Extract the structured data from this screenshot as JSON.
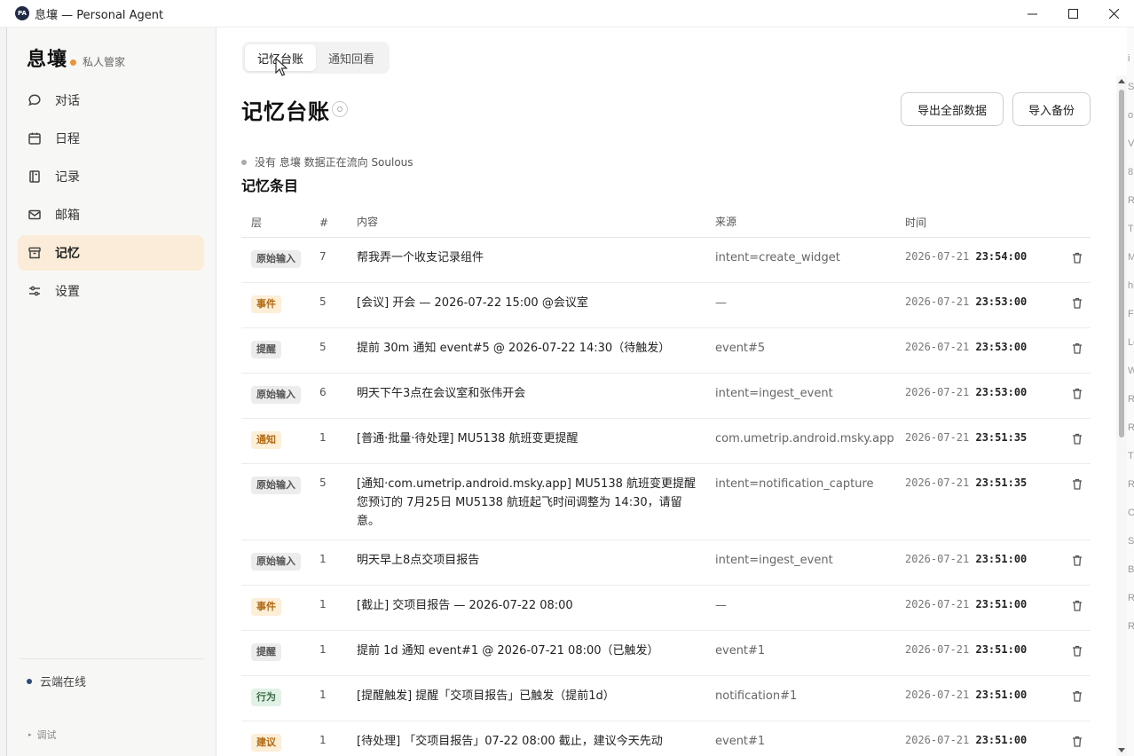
{
  "window": {
    "title": "息壤 — Personal Agent",
    "icon_label": "PA",
    "controls": {
      "minimize": "—",
      "maximize": "☐",
      "close": "✕"
    }
  },
  "sidebar": {
    "brand": "息壤",
    "brand_sub": "私人管家",
    "items": [
      {
        "label": "对话",
        "icon": "chat-icon",
        "active": false
      },
      {
        "label": "日程",
        "icon": "calendar-icon",
        "active": false
      },
      {
        "label": "记录",
        "icon": "notebook-icon",
        "active": false
      },
      {
        "label": "邮箱",
        "icon": "mail-icon",
        "active": false
      },
      {
        "label": "记忆",
        "icon": "archive-icon",
        "active": true
      },
      {
        "label": "设置",
        "icon": "sliders-icon",
        "active": false
      }
    ],
    "cloud_status": "云端在线",
    "debug": "调试"
  },
  "main": {
    "tabs": [
      {
        "label": "记忆台账",
        "active": true
      },
      {
        "label": "通知回看",
        "active": false
      }
    ],
    "page_title": "记忆台账",
    "export_button": "导出全部数据",
    "import_button": "导入备份",
    "flow_note": "没有 息壤 数据正在流向 Soulous",
    "section_title": "记忆条目",
    "columns": {
      "layer": "层",
      "num": "#",
      "content": "内容",
      "source": "来源",
      "time": "时间"
    },
    "rows": [
      {
        "layer": "原始输入",
        "tag": "gray",
        "num": "7",
        "content": "帮我弄一个收支记录组件",
        "source": "intent=create_widget",
        "date": "2026-07-21",
        "time": "23:54:00"
      },
      {
        "layer": "事件",
        "tag": "orange",
        "num": "5",
        "content": "[会议] 开会 — 2026-07-22 15:00 @会议室",
        "source": "—",
        "date": "2026-07-21",
        "time": "23:53:00"
      },
      {
        "layer": "提醒",
        "tag": "gray",
        "num": "5",
        "content": "提前 30m 通知 event#5 @ 2026-07-22 14:30（待触发）",
        "source": "event#5",
        "date": "2026-07-21",
        "time": "23:53:00"
      },
      {
        "layer": "原始输入",
        "tag": "gray",
        "num": "6",
        "content": "明天下午3点在会议室和张伟开会",
        "source": "intent=ingest_event",
        "date": "2026-07-21",
        "time": "23:53:00"
      },
      {
        "layer": "通知",
        "tag": "orange",
        "num": "1",
        "content": "[普通·批量·待处理] MU5138 航班变更提醒",
        "source": "com.umetrip.android.msky.app",
        "date": "2026-07-21",
        "time": "23:51:35"
      },
      {
        "layer": "原始输入",
        "tag": "gray",
        "num": "5",
        "content": "[通知·com.umetrip.android.msky.app] MU5138 航班变更提醒 您预订的 7月25日 MU5138 航班起飞时间调整为 14:30，请留意。",
        "source": "intent=notification_capture",
        "date": "2026-07-21",
        "time": "23:51:35"
      },
      {
        "layer": "原始输入",
        "tag": "gray",
        "num": "1",
        "content": "明天早上8点交项目报告",
        "source": "intent=ingest_event",
        "date": "2026-07-21",
        "time": "23:51:00"
      },
      {
        "layer": "事件",
        "tag": "orange",
        "num": "1",
        "content": "[截止] 交项目报告 — 2026-07-22 08:00",
        "source": "—",
        "date": "2026-07-21",
        "time": "23:51:00"
      },
      {
        "layer": "提醒",
        "tag": "gray",
        "num": "1",
        "content": "提前 1d 通知 event#1 @ 2026-07-21 08:00（已触发）",
        "source": "event#1",
        "date": "2026-07-21",
        "time": "23:51:00"
      },
      {
        "layer": "行为",
        "tag": "green",
        "num": "1",
        "content": "[提醒触发] 提醒「交项目报告」已触发（提前1d）",
        "source": "notification#1",
        "date": "2026-07-21",
        "time": "23:51:00"
      },
      {
        "layer": "建议",
        "tag": "orange",
        "num": "1",
        "content": "[待处理] 「交项目报告」07-22 08:00 截止，建议今天先动",
        "source": "event#1",
        "date": "2026-07-21",
        "time": "23:51:00"
      }
    ]
  },
  "colors": {
    "accent": "#e8953a",
    "active_bg": "#fbecd9",
    "tag_gray": "#ececec",
    "tag_orange": "#fdeed8",
    "tag_green": "#e2f1e6"
  },
  "background_glyphs": [
    "i",
    "S",
    "o",
    "V",
    "8",
    "R",
    "T",
    "M",
    "hi",
    "Fi",
    "Lo",
    "W",
    "Ri",
    "Ri",
    "Ti",
    "R",
    "Ci",
    "S",
    "B",
    "R",
    "R"
  ]
}
